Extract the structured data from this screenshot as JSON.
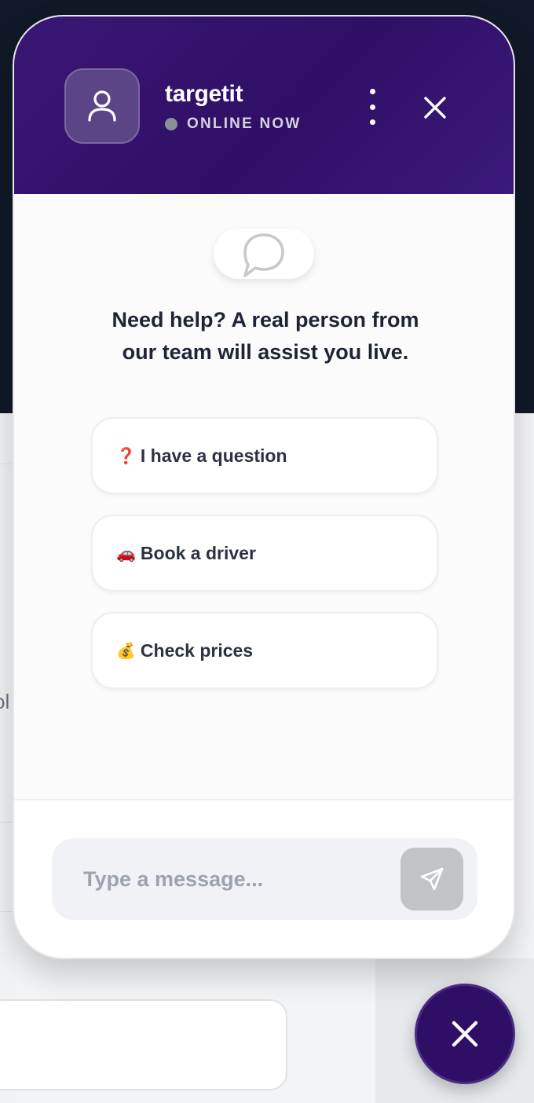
{
  "background": {
    "cut_text": "ol"
  },
  "header": {
    "brand_name": "targetit",
    "status_text": "ONLINE NOW",
    "avatar_icon": "user-icon",
    "menu_icon": "more-vertical-icon",
    "close_icon": "close-icon",
    "colors": {
      "header_bg": "#2f0f66",
      "status_dot": "#8a8f9a"
    }
  },
  "body": {
    "bubble_icon": "chat-bubble-icon",
    "help_line_1": "Need help? A real person from",
    "help_line_2": "our team will assist you live."
  },
  "options": [
    {
      "emoji": "❓",
      "label": "I have a question"
    },
    {
      "emoji": "🚗",
      "label": "Book a driver"
    },
    {
      "emoji": "💰",
      "label": "Check prices"
    }
  ],
  "composer": {
    "placeholder": "Type a message...",
    "value": "",
    "send_icon": "send-icon"
  },
  "launcher": {
    "icon": "close-icon",
    "color": "#2f0f66"
  }
}
